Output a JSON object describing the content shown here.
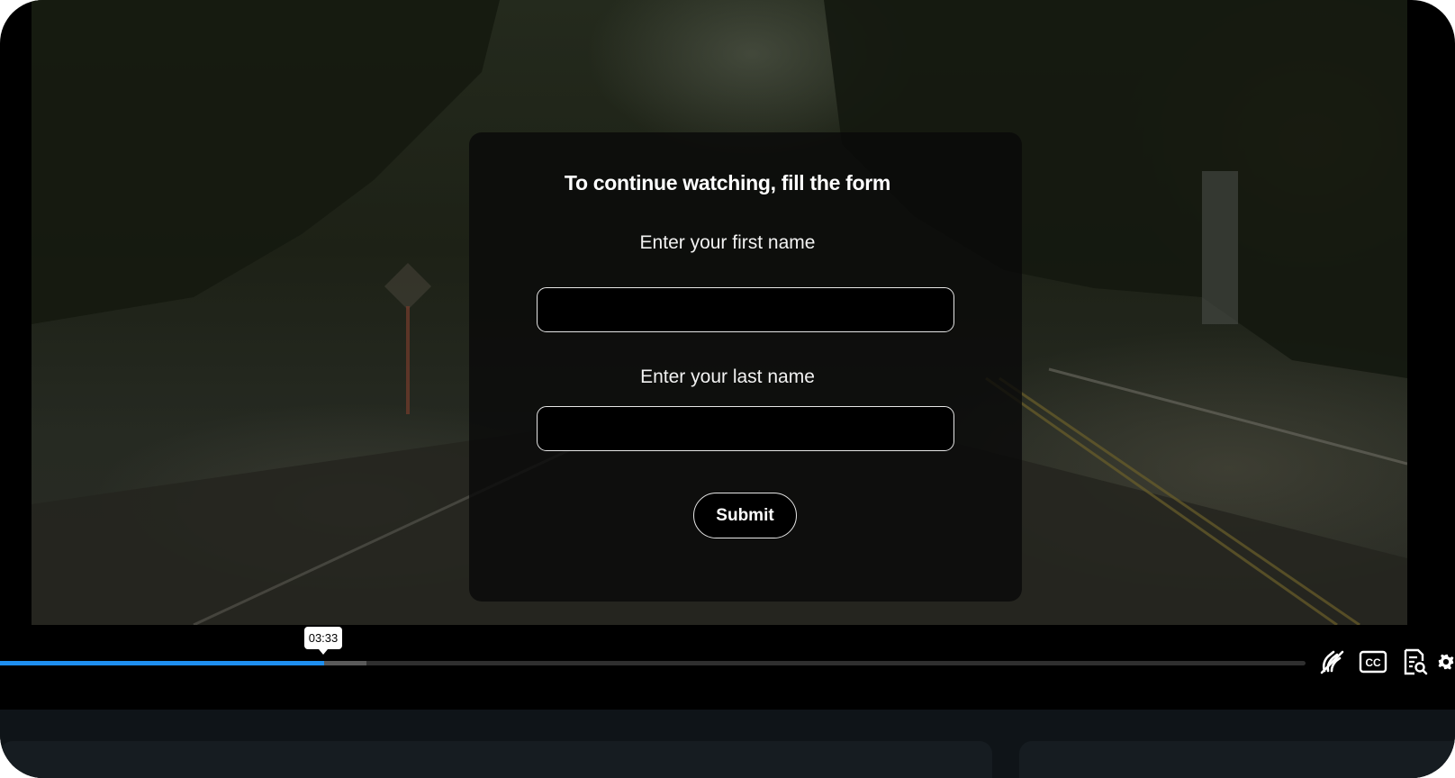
{
  "modal": {
    "title": "To continue watching, fill the form",
    "first_name_label": "Enter your first name",
    "first_name_value": "",
    "last_name_label": "Enter your last name",
    "last_name_value": "",
    "submit_label": "Submit"
  },
  "player": {
    "current_time": "03:33",
    "played_fraction": 0.248,
    "buffered_fraction": 0.281,
    "accent_color": "#1e8ff0",
    "controls": [
      {
        "name": "sign-language-off-icon"
      },
      {
        "name": "closed-captions-icon",
        "label": "CC"
      },
      {
        "name": "transcript-search-icon"
      },
      {
        "name": "gear-icon"
      }
    ]
  }
}
